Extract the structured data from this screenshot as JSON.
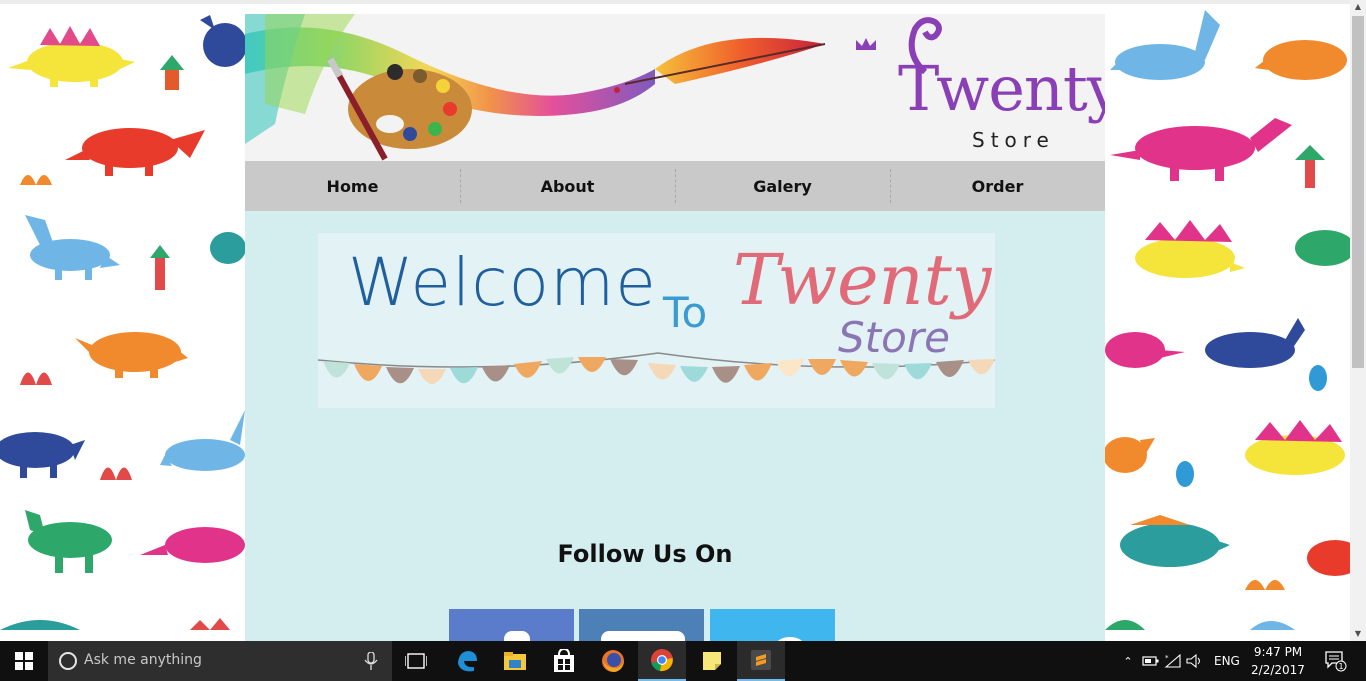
{
  "header": {
    "logo_main": "Twenty",
    "logo_sub": "Store"
  },
  "nav": {
    "items": [
      {
        "label": "Home"
      },
      {
        "label": "About"
      },
      {
        "label": "Galery"
      },
      {
        "label": "Order"
      }
    ]
  },
  "welcome_banner": {
    "line1": "Welcome",
    "line2": "To",
    "brand": "Twenty",
    "brand_sub": "Store"
  },
  "follow": {
    "title": "Follow Us On",
    "networks": [
      {
        "icon": "facebook-icon",
        "color": "#5b7ccb"
      },
      {
        "icon": "instagram-icon",
        "color": "#4d80b7"
      },
      {
        "icon": "twitter-icon",
        "color": "#3fb6ee"
      }
    ]
  },
  "taskbar": {
    "search_placeholder": "Ask me anything",
    "apps": [
      "task-view-icon",
      "edge-icon",
      "file-explorer-icon",
      "store-icon",
      "firefox-icon",
      "chrome-icon",
      "sticky-notes-icon",
      "sublime-icon"
    ],
    "language": "ENG",
    "time": "9:47 PM",
    "date": "2/2/2017",
    "notification_count": "1"
  },
  "colors": {
    "content_bg": "#d4edee",
    "nav_bg": "#c9c9c9",
    "logo_purple": "#8a3fb6",
    "taskbar_bg": "#101010"
  }
}
